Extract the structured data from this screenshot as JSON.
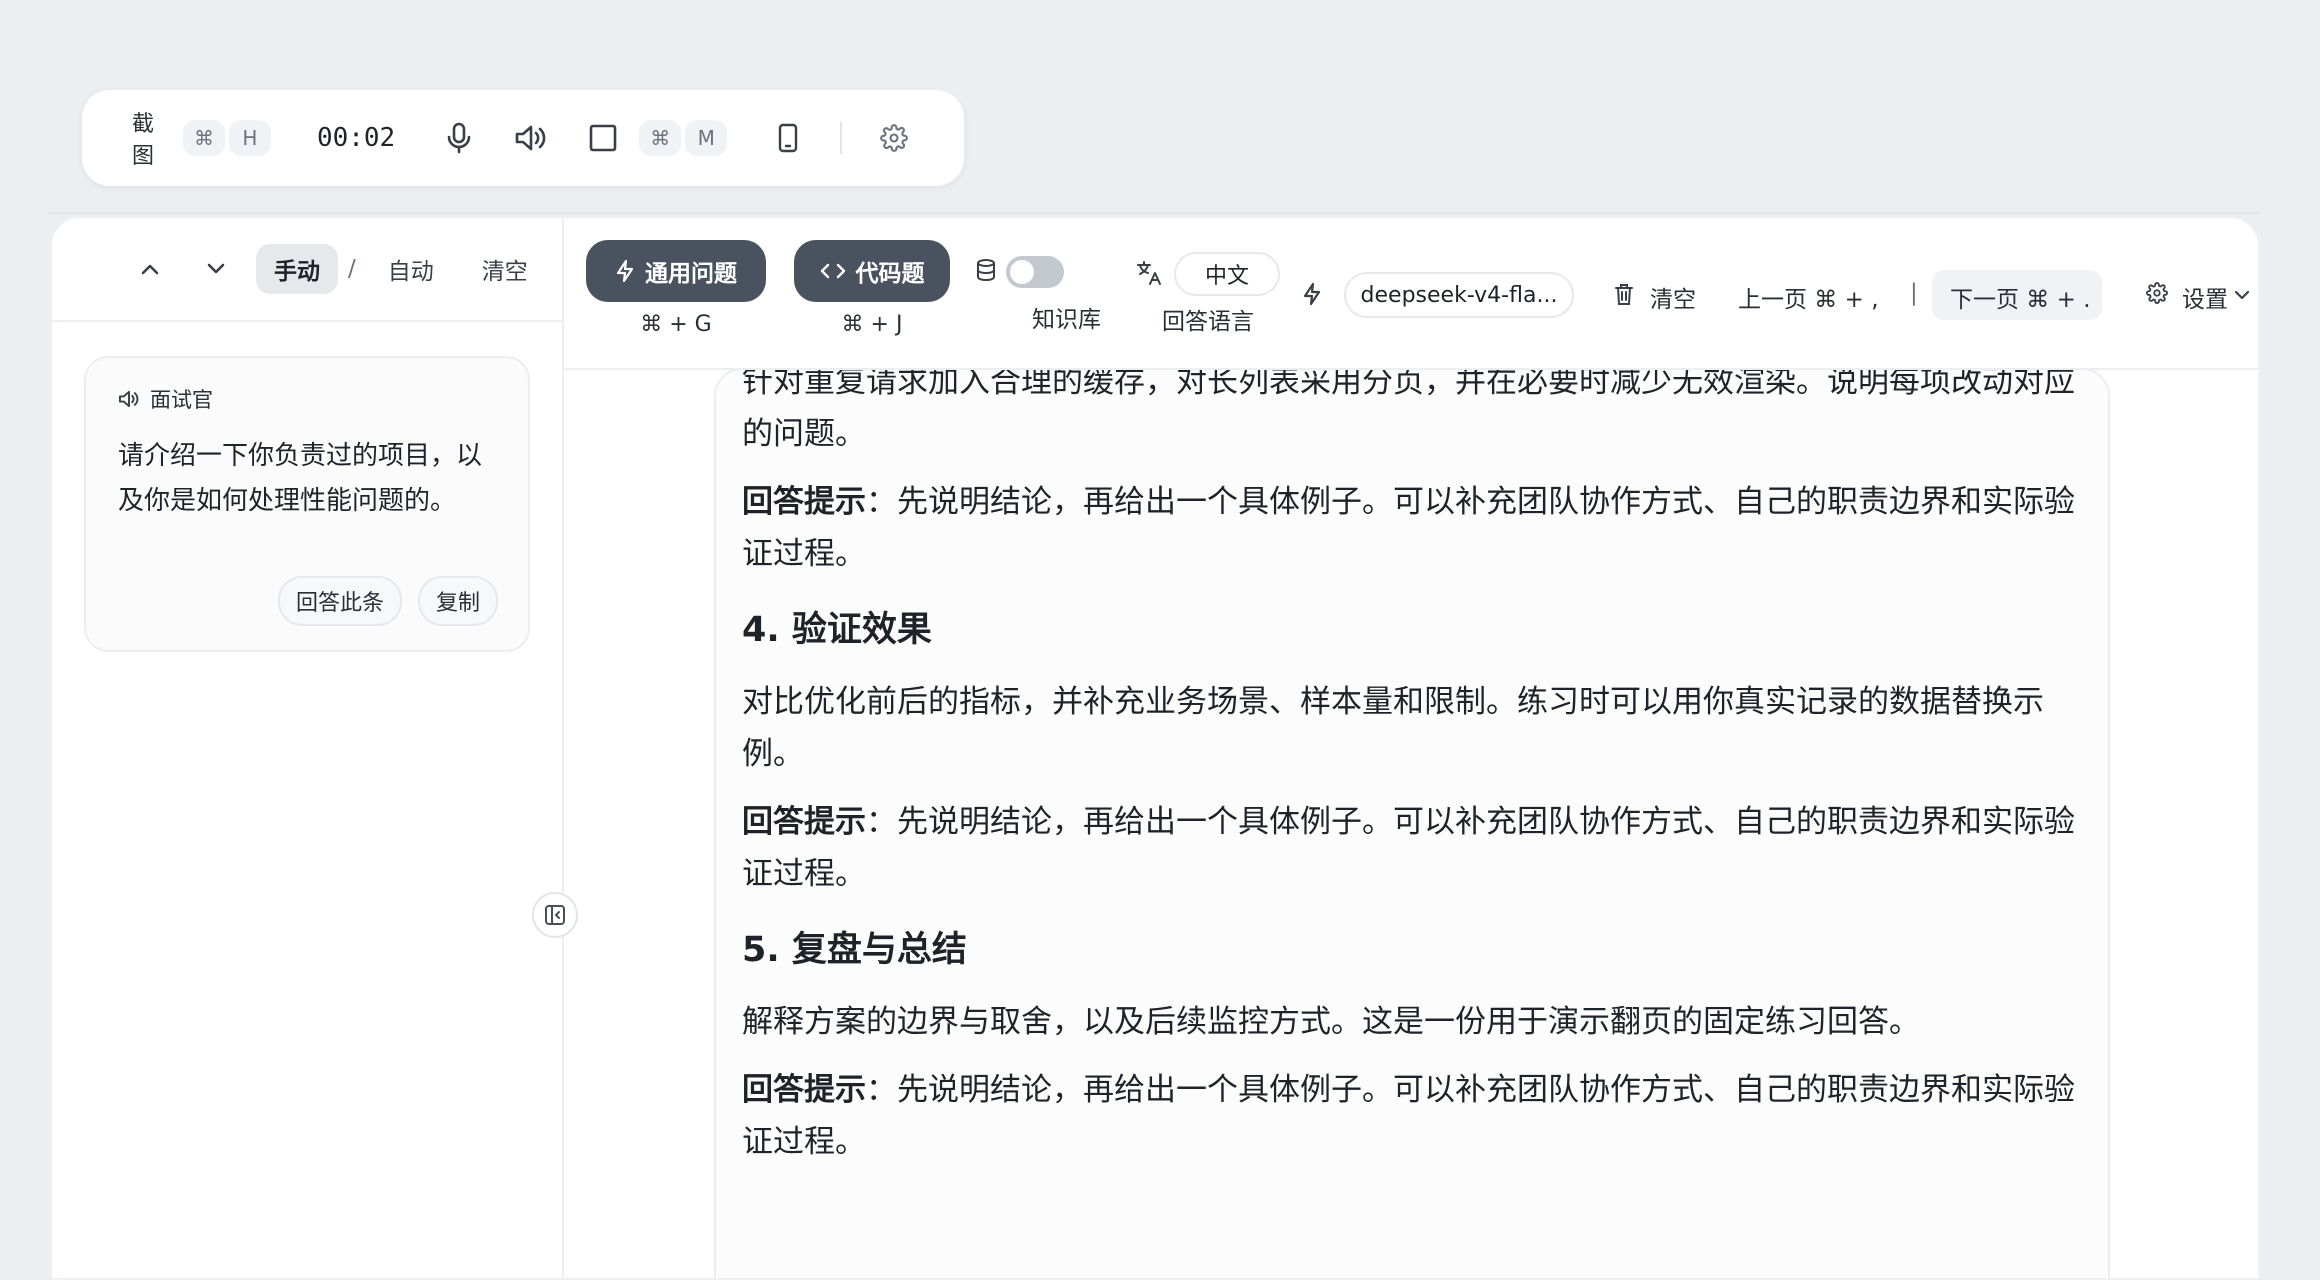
{
  "toolbar": {
    "screenshot_label": "截图",
    "screenshot_keys": [
      "⌘",
      "H"
    ],
    "timer": "00:02",
    "window_keys": [
      "⌘",
      "M"
    ]
  },
  "left": {
    "modes": {
      "manual": "手动",
      "slash": "/",
      "auto": "自动",
      "clear": "清空"
    },
    "question": {
      "speaker": "面试官",
      "text": "请介绍一下你负责过的项目，以及你是如何处理性能问题的。",
      "answer_btn": "回答此条",
      "copy_btn": "复制"
    }
  },
  "header": {
    "general_btn": "通用问题",
    "general_shortcut": "⌘ + G",
    "code_btn": "代码题",
    "code_shortcut": "⌘ + J",
    "kb_label": "知识库",
    "lang_value": "中文",
    "lang_label": "回答语言",
    "model": "deepseek-v4-fla...",
    "clear": "清空",
    "prev": "上一页 ⌘ + ,",
    "divider": "|",
    "next": "下一页 ⌘ + .",
    "settings": "设置"
  },
  "answer": {
    "p1": "针对重复请求加入合理的缓存，对长列表采用分页，并在必要时减少无效渲染。说明每项改动对应的问题。",
    "hint_label": "回答提示",
    "hint_text": "：先说明结论，再给出一个具体例子。可以补充团队协作方式、自己的职责边界和实际验证过程。",
    "h4": "4. 验证效果",
    "p4": "对比优化前后的指标，并补充业务场景、样本量和限制。练习时可以用你真实记录的数据替换示例。",
    "h5": "5. 复盘与总结",
    "p5": "解释方案的边界与取舍，以及后续监控方式。这是一份用于演示翻页的固定练习回答。"
  }
}
